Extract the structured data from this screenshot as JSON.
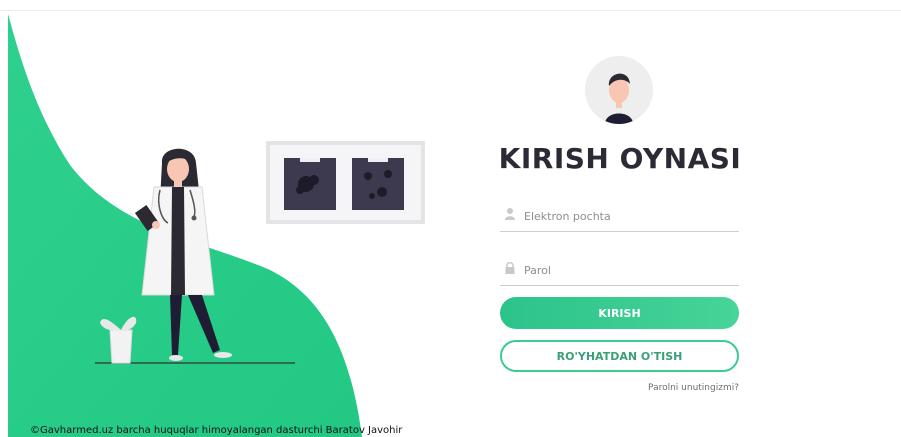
{
  "login": {
    "title": "KIRISH OYNASI",
    "email_placeholder": "Elektron pochta",
    "password_placeholder": "Parol",
    "login_button": "KIRISH",
    "register_button": "RO'YHATDAN O'TISH",
    "forgot_link": "Parolni unutingizmi?"
  },
  "icons": {
    "avatar": "user-avatar-icon",
    "email": "user-icon",
    "password": "lock-icon"
  },
  "colors": {
    "brand_green": "#2fcb8c",
    "title": "#2b2b35",
    "xray_film": "#3d3a4f"
  },
  "footer": {
    "copyright": "©Gavharmed.uz barcha huquqlar himoyalangan dasturchi Baratov Javohir"
  }
}
